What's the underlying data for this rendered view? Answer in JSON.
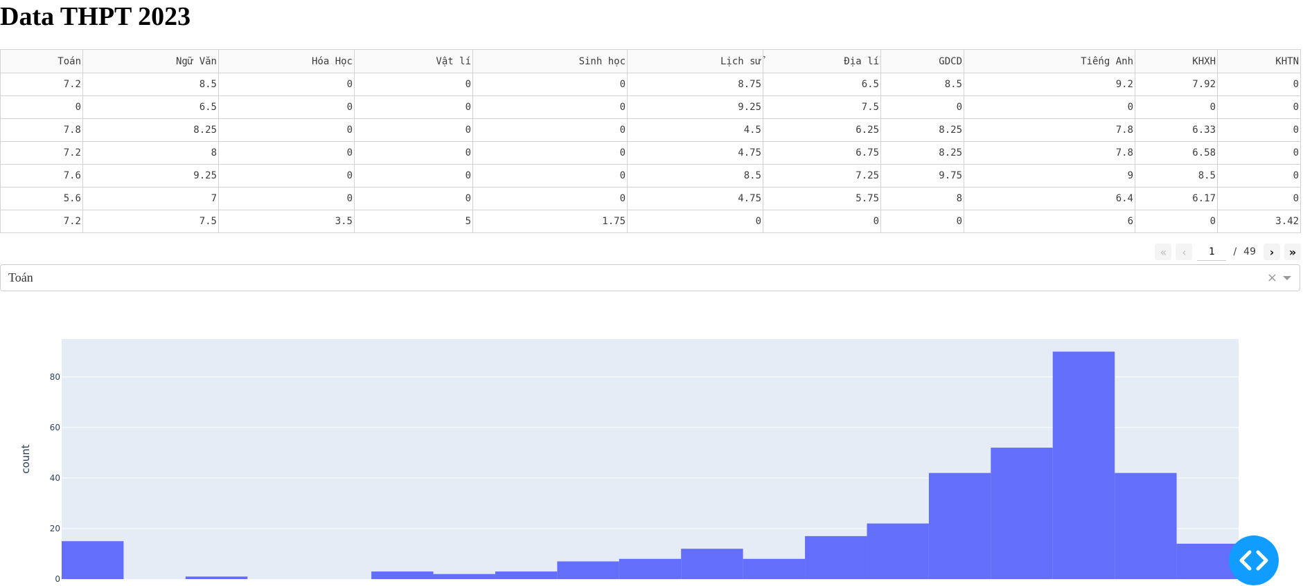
{
  "page": {
    "title": "Data THPT 2023"
  },
  "table": {
    "columns": [
      "Toán",
      "Ngữ Văn",
      "Hóa Học",
      "Vật lí",
      "Sinh học",
      "Lịch sử",
      "Địa lí",
      "GDCD",
      "Tiếng Anh",
      "KHXH",
      "KHTN"
    ],
    "rows": [
      [
        "7.2",
        "8.5",
        "0",
        "0",
        "0",
        "8.75",
        "6.5",
        "8.5",
        "9.2",
        "7.92",
        "0"
      ],
      [
        "0",
        "6.5",
        "0",
        "0",
        "0",
        "9.25",
        "7.5",
        "0",
        "0",
        "0",
        "0"
      ],
      [
        "7.8",
        "8.25",
        "0",
        "0",
        "0",
        "4.5",
        "6.25",
        "8.25",
        "7.8",
        "6.33",
        "0"
      ],
      [
        "7.2",
        "8",
        "0",
        "0",
        "0",
        "4.75",
        "6.75",
        "8.25",
        "7.8",
        "6.58",
        "0"
      ],
      [
        "7.6",
        "9.25",
        "0",
        "0",
        "0",
        "8.5",
        "7.25",
        "9.75",
        "9",
        "8.5",
        "0"
      ],
      [
        "5.6",
        "7",
        "0",
        "0",
        "0",
        "4.75",
        "5.75",
        "8",
        "6.4",
        "6.17",
        "0"
      ],
      [
        "7.2",
        "7.5",
        "3.5",
        "5",
        "1.75",
        "0",
        "0",
        "0",
        "6",
        "0",
        "3.42"
      ]
    ]
  },
  "pagination": {
    "first_icon": "«",
    "prev_icon": "‹",
    "current": "1",
    "separator": "/",
    "total": "49",
    "next_icon": "›",
    "last_icon": "»"
  },
  "dropdown": {
    "selected": "Toán",
    "clear_icon": "×"
  },
  "chart_data": {
    "type": "bar",
    "ylabel": "count",
    "ylim": [
      0,
      95
    ],
    "yticks": [
      0,
      20,
      40,
      60,
      80
    ],
    "bins": 19,
    "values": [
      15,
      0,
      1,
      0,
      0,
      3,
      2,
      3,
      7,
      8,
      12,
      8,
      17,
      22,
      42,
      52,
      90,
      42,
      14
    ],
    "bar_color": "#636efa",
    "plot_bg": "#e5ecf6",
    "grid": true
  },
  "fab": {
    "icon": "code-icon",
    "color": "#119dff"
  }
}
